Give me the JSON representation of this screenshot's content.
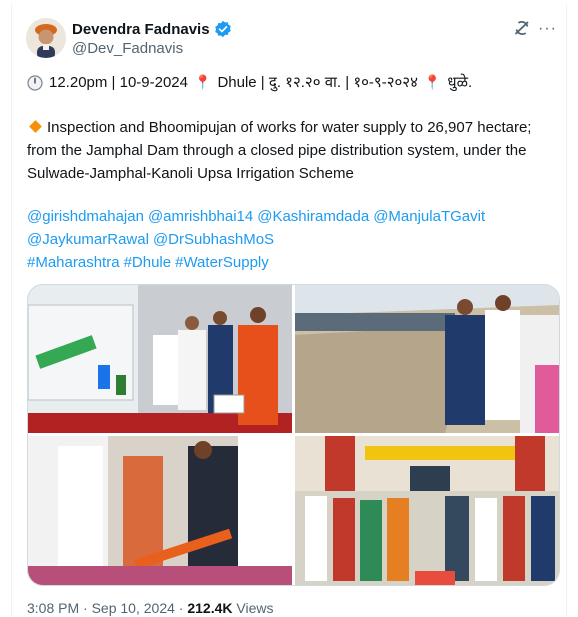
{
  "author": {
    "name": "Devendra Fadnavis",
    "handle": "@Dev_Fadnavis",
    "verified": true,
    "avatar_icon": "avatar-photo"
  },
  "tweet": {
    "line1": "12.20pm | 10-9-2024",
    "line1_b": "Dhule | दु. १२.२० वा. | १०-९-२०२४",
    "line1_c": "धुळे.",
    "paragraph": "Inspection and Bhoomipujan of works for water supply to 26,907 hectare; from the Jamphal Dam through a closed pipe distribution system, under the Sulwade-Jamphal-Kanoli Upsa Irrigation Scheme",
    "mentions": [
      "@girishdmahajan",
      "@amrishbhai14",
      "@Kashiramdada",
      "@ManjulaTGavit",
      "@JaykumarRawal",
      "@DrSubhashMoS"
    ],
    "hashtags": [
      "#Maharashtra",
      "#Dhule",
      "#WaterSupply"
    ]
  },
  "meta": {
    "time": "3:08 PM",
    "date": "Sep 10, 2024",
    "views_count": "212.4K",
    "views_label": "Views"
  },
  "colors": {
    "link": "#1d9bf0",
    "verified": "#1d9bf0",
    "muted": "#536471",
    "pin": "#e0245e",
    "diamond": "#f4900c"
  }
}
